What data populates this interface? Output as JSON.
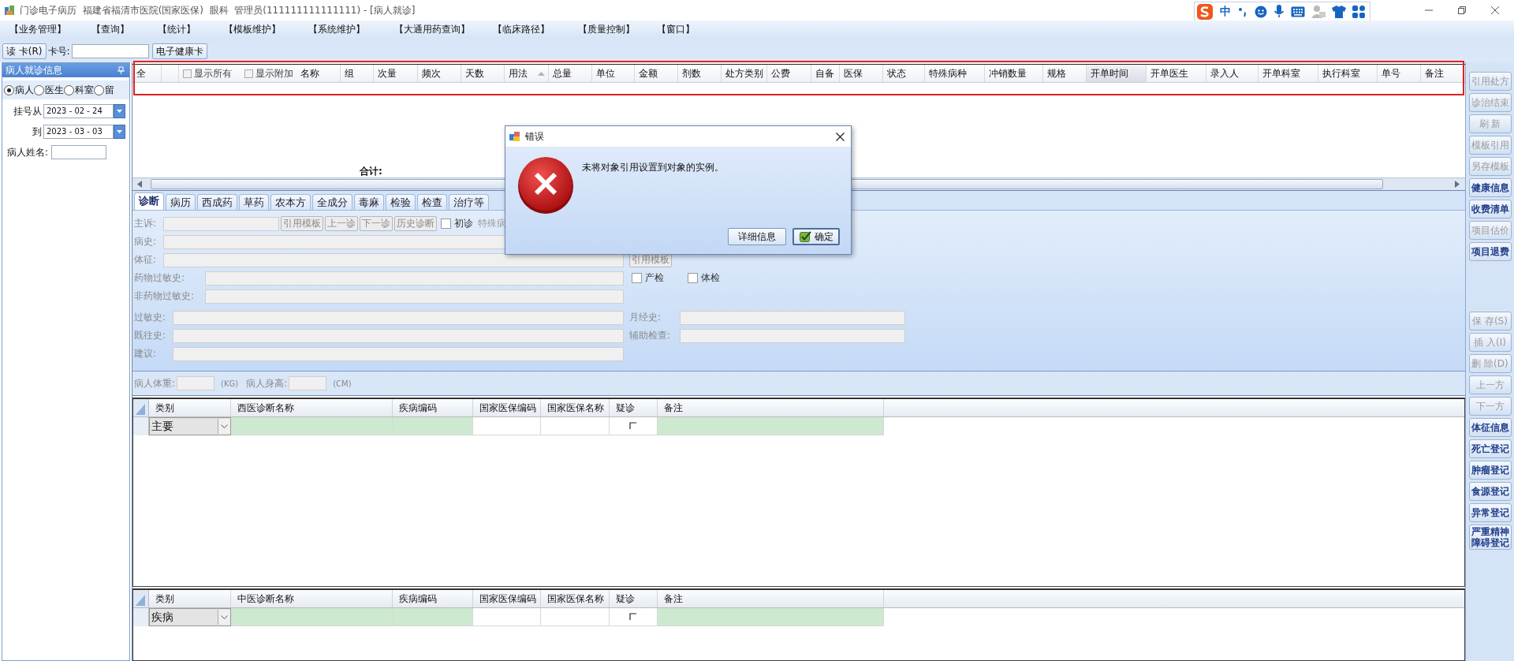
{
  "title_bar": {
    "title": "门诊电子病历  福建省福清市医院(国家医保)  眼科  管理员(111111111111111) - [病人就诊]"
  },
  "ime_toolbar": {
    "mode": "中"
  },
  "menu": [
    "【业务管理】",
    "【查询】",
    "【统计】",
    "【模板维护】",
    "【系统维护】",
    "【大通用药查询】",
    "【临床路径】",
    "【质量控制】",
    "【窗口】"
  ],
  "toolbar": {
    "read_card_button": "读 卡(R)",
    "card_label": "卡号:",
    "health_card_button": "电子健康卡"
  },
  "left_panel": {
    "title": "病人就诊信息",
    "radios": [
      {
        "label": "病人",
        "selected": true
      },
      {
        "label": "医生",
        "selected": false
      },
      {
        "label": "科室",
        "selected": false
      },
      {
        "label": "留",
        "selected": false
      }
    ],
    "date_from": {
      "label": "挂号从",
      "value": "2023 - 02 - 24"
    },
    "date_to": {
      "label": "到",
      "value": "2023 - 03 - 03"
    },
    "name_label": "病人姓名:"
  },
  "drug_table": {
    "select_all": "全",
    "show_all": {
      "label": "显示所有",
      "checked": false
    },
    "show_extra": {
      "label": "显示附加",
      "checked": false
    },
    "columns": [
      {
        "label": "名称",
        "highlighted": false,
        "sorted": false
      },
      {
        "label": "组",
        "highlighted": false,
        "sorted": false
      },
      {
        "label": "次量",
        "highlighted": false,
        "sorted": false
      },
      {
        "label": "频次",
        "highlighted": false,
        "sorted": false
      },
      {
        "label": "天数",
        "highlighted": false,
        "sorted": false
      },
      {
        "label": "用法",
        "highlighted": false,
        "sorted": true
      },
      {
        "label": "总量",
        "highlighted": false,
        "sorted": false
      },
      {
        "label": "单位",
        "highlighted": false,
        "sorted": false
      },
      {
        "label": "金额",
        "highlighted": false,
        "sorted": false
      },
      {
        "label": "剂数",
        "highlighted": false,
        "sorted": false
      },
      {
        "label": "处方类别",
        "highlighted": false,
        "sorted": false
      },
      {
        "label": "公费",
        "highlighted": false,
        "sorted": false
      },
      {
        "label": "自备",
        "highlighted": false,
        "sorted": false
      },
      {
        "label": "医保",
        "highlighted": false,
        "sorted": false
      },
      {
        "label": "状态",
        "highlighted": false,
        "sorted": false
      },
      {
        "label": "特殊病种",
        "highlighted": false,
        "sorted": false
      },
      {
        "label": "冲销数量",
        "highlighted": false,
        "sorted": false
      },
      {
        "label": "规格",
        "highlighted": false,
        "sorted": false
      },
      {
        "label": "开单时间",
        "highlighted": true,
        "sorted": false
      },
      {
        "label": "开单医生",
        "highlighted": false,
        "sorted": false
      },
      {
        "label": "录入人",
        "highlighted": false,
        "sorted": false
      },
      {
        "label": "开单科室",
        "highlighted": false,
        "sorted": false
      },
      {
        "label": "执行科室",
        "highlighted": false,
        "sorted": false
      },
      {
        "label": "单号",
        "highlighted": false,
        "sorted": false
      },
      {
        "label": "备注",
        "highlighted": false,
        "sorted": false
      }
    ],
    "highlight_frame": true,
    "total_label": "合计:"
  },
  "tabs": [
    {
      "label": "诊断",
      "selected": true
    },
    {
      "label": "病历",
      "selected": false
    },
    {
      "label": "西成药",
      "selected": false
    },
    {
      "label": "草药",
      "selected": false
    },
    {
      "label": "农本方",
      "selected": false
    },
    {
      "label": "全成分",
      "selected": false
    },
    {
      "label": "毒麻",
      "selected": false
    },
    {
      "label": "检验",
      "selected": false
    },
    {
      "label": "检查",
      "selected": false
    },
    {
      "label": "治疗等",
      "selected": false
    }
  ],
  "diagnosis_form": {
    "complaint_label": "主诉:",
    "complaint_buttons": [
      "引用模板",
      "上一诊",
      "下一诊",
      "历史诊断"
    ],
    "first_visit": {
      "label": "初诊",
      "checked": false
    },
    "special_label": "特殊病",
    "history_label": "病史:",
    "signs_label": "体征:",
    "template_button": "引用模板",
    "drug_allergy_label": "药物过敏史:",
    "non_drug_allergy_label": "非药物过敏史:",
    "exam_checks": [
      {
        "label": "产检",
        "checked": false
      },
      {
        "label": "体检",
        "checked": false
      }
    ],
    "allergy_label": "过敏史:",
    "past_history_label": "既往史:",
    "advice_label": "建议:",
    "menstrual_label": "月经史:",
    "aux_exam_label": "辅助检查:"
  },
  "measurements": {
    "weight_label": "病人体重:",
    "weight_unit": "(KG)",
    "height_label": "病人身高:",
    "height_unit": "(CM)"
  },
  "western_grid": {
    "columns": [
      {
        "label": "类别",
        "kind": "combo"
      },
      {
        "label": "西医诊断名称",
        "kind": "input"
      },
      {
        "label": "疾病编码",
        "kind": "input"
      },
      {
        "label": "国家医保编码",
        "kind": "plain"
      },
      {
        "label": "国家医保名称",
        "kind": "plain"
      },
      {
        "label": "疑诊",
        "kind": "check"
      },
      {
        "label": "备注",
        "kind": "input"
      }
    ],
    "row": {
      "category": "主要",
      "suspected": false
    }
  },
  "tcm_grid": {
    "columns": [
      {
        "label": "类别",
        "kind": "combo"
      },
      {
        "label": "中医诊断名称",
        "kind": "input"
      },
      {
        "label": "疾病编码",
        "kind": "input"
      },
      {
        "label": "国家医保编码",
        "kind": "plain"
      },
      {
        "label": "国家医保名称",
        "kind": "plain"
      },
      {
        "label": "疑诊",
        "kind": "check"
      },
      {
        "label": "备注",
        "kind": "input"
      }
    ],
    "row": {
      "category": "疾病",
      "suspected": false
    }
  },
  "side_buttons_top": [
    {
      "label": "引用处方",
      "disabled": true
    },
    {
      "label": "诊治结束",
      "disabled": true
    },
    {
      "label": "刷 新",
      "disabled": true
    },
    {
      "label": "模板引用",
      "disabled": true
    },
    {
      "label": "另存模板",
      "disabled": true
    },
    {
      "label": "健康信息",
      "disabled": false
    },
    {
      "label": "收费清单",
      "disabled": false
    },
    {
      "label": "项目估价",
      "disabled": true
    },
    {
      "label": "项目退费",
      "disabled": false
    }
  ],
  "side_buttons_bottom": [
    {
      "label": "保 存(S)",
      "disabled": true
    },
    {
      "label": "插 入(I)",
      "disabled": true
    },
    {
      "label": "删 除(D)",
      "disabled": true
    },
    {
      "label": "上一方",
      "disabled": true
    },
    {
      "label": "下一方",
      "disabled": true
    },
    {
      "label": "体征信息",
      "disabled": false
    },
    {
      "label": "死亡登记",
      "disabled": false
    },
    {
      "label": "肿瘤登记",
      "disabled": false
    },
    {
      "label": "食源登记",
      "disabled": false
    },
    {
      "label": "异常登记",
      "disabled": false
    },
    {
      "label": "严重精神障碍登记",
      "disabled": false
    }
  ],
  "dialog": {
    "title": "错误",
    "message": "未将对象引用设置到对象的实例。",
    "buttons": [
      {
        "label": "详细信息",
        "kind": "plain"
      },
      {
        "label": "确定",
        "kind": "default"
      }
    ]
  }
}
